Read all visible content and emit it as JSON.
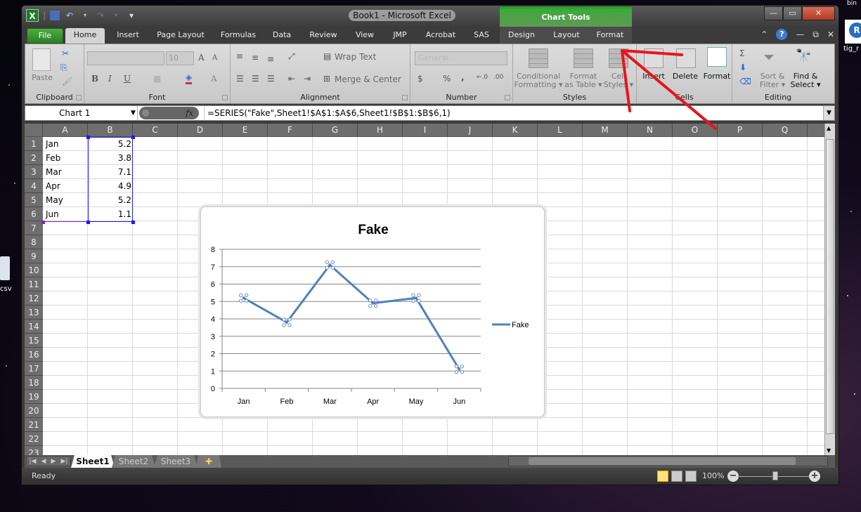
{
  "window": {
    "title": "Book1  -  Microsoft Excel",
    "context_group": "Chart Tools",
    "controls": {
      "minimize": "—",
      "restore": "▭",
      "close": "✕"
    }
  },
  "quick_access": {
    "logo": "X",
    "save": "💾",
    "undo": "↶",
    "redo": "↷",
    "customize": "▾"
  },
  "ribbon_tabs": [
    "File",
    "Home",
    "Insert",
    "Page Layout",
    "Formulas",
    "Data",
    "Review",
    "View",
    "JMP",
    "Acrobat",
    "SAS"
  ],
  "context_tabs": [
    "Design",
    "Layout",
    "Format"
  ],
  "active_tab": "Home",
  "ribbon": {
    "clipboard": {
      "label": "Clipboard",
      "paste": "Paste"
    },
    "font": {
      "label": "Font",
      "font_name": "",
      "font_size": "10",
      "bold": "B",
      "italic": "I",
      "underline": "U"
    },
    "alignment": {
      "label": "Alignment",
      "wrap_text": "Wrap Text",
      "merge_center": "Merge & Center"
    },
    "number": {
      "label": "Number",
      "format": "General",
      "currency": "$",
      "percent": "%",
      "comma": ","
    },
    "styles": {
      "label": "Styles",
      "conditional": "Conditional",
      "conditional2": "Formatting",
      "format_table": "Format",
      "format_table2": "as Table",
      "cell_styles": "Cell",
      "cell_styles2": "Styles"
    },
    "cells": {
      "label": "Cells",
      "insert": "Insert",
      "delete": "Delete",
      "format": "Format"
    },
    "editing": {
      "label": "Editing",
      "sum": "Σ",
      "sort": "Sort &",
      "sort2": "Filter",
      "find": "Find &",
      "find2": "Select"
    }
  },
  "formula_bar": {
    "name_box": "Chart 1",
    "fx": "fx",
    "formula": "=SERIES(\"Fake\",Sheet1!$A$1:$A$6,Sheet1!$B$1:$B$6,1)"
  },
  "columns": [
    "A",
    "B",
    "C",
    "D",
    "E",
    "F",
    "G",
    "H",
    "I",
    "J",
    "K",
    "L",
    "M",
    "N",
    "O",
    "P",
    "Q"
  ],
  "rows": [
    "1",
    "2",
    "3",
    "4",
    "5",
    "6",
    "7",
    "8",
    "9",
    "10",
    "11",
    "12",
    "13",
    "14",
    "15",
    "16",
    "17",
    "18",
    "19",
    "20",
    "21",
    "22",
    "23"
  ],
  "cells": [
    {
      "a": "Jan",
      "b": "5.2"
    },
    {
      "a": "Feb",
      "b": "3.8"
    },
    {
      "a": "Mar",
      "b": "7.1"
    },
    {
      "a": "Apr",
      "b": "4.9"
    },
    {
      "a": "May",
      "b": "5.2"
    },
    {
      "a": "Jun",
      "b": "1.1"
    }
  ],
  "chart_data": {
    "type": "line",
    "title": "Fake",
    "categories": [
      "Jan",
      "Feb",
      "Mar",
      "Apr",
      "May",
      "Jun"
    ],
    "series": [
      {
        "name": "Fake",
        "values": [
          5.2,
          3.8,
          7.1,
          4.9,
          5.2,
          1.1
        ],
        "color": "#4f81bd"
      }
    ],
    "xlabel": "",
    "ylabel": "",
    "ylim": [
      0,
      8
    ],
    "yticks": [
      "0",
      "1",
      "2",
      "3",
      "4",
      "5",
      "6",
      "7",
      "8"
    ],
    "grid": true,
    "legend": "right"
  },
  "sheets": [
    "Sheet1",
    "Sheet2",
    "Sheet3"
  ],
  "active_sheet": "Sheet1",
  "status": {
    "ready": "Ready",
    "zoom": "100%"
  },
  "desktop": {
    "left_icon_label": "csv",
    "right_icon_label": "tig_r",
    "right_icon": "R"
  },
  "colors": {
    "accent_green": "#3fa83b",
    "series_blue": "#4f81bd",
    "annotation_red": "#e8141e",
    "selection_blue": "#1a1aff",
    "selection_purple": "#8c1fbf"
  }
}
